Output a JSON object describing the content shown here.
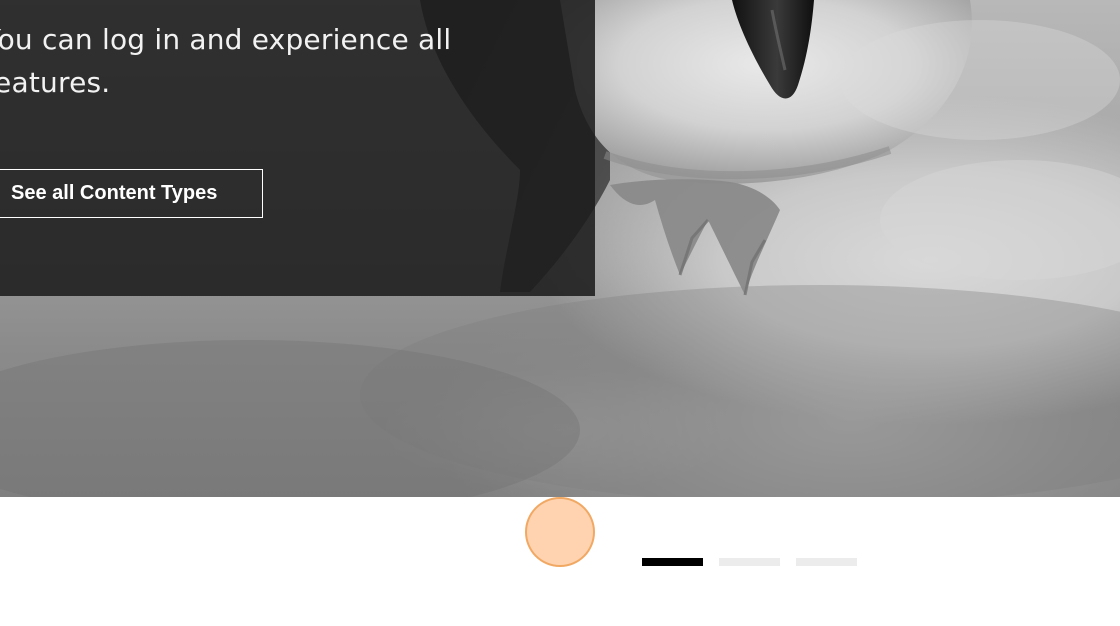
{
  "hero": {
    "panel_text": "You can log in and experience all features.",
    "cta_label": "See all Content Types"
  },
  "carousel": {
    "indicators": [
      {
        "name": "slide-1",
        "active": true
      },
      {
        "name": "slide-2",
        "active": false
      },
      {
        "name": "slide-3",
        "active": false
      }
    ]
  },
  "colors": {
    "panel_bg": "#1c1c1c",
    "text": "#f2f2f2",
    "indicator_active": "#000000",
    "indicator_inactive": "#ececec",
    "click_marker": "#ffc496"
  }
}
